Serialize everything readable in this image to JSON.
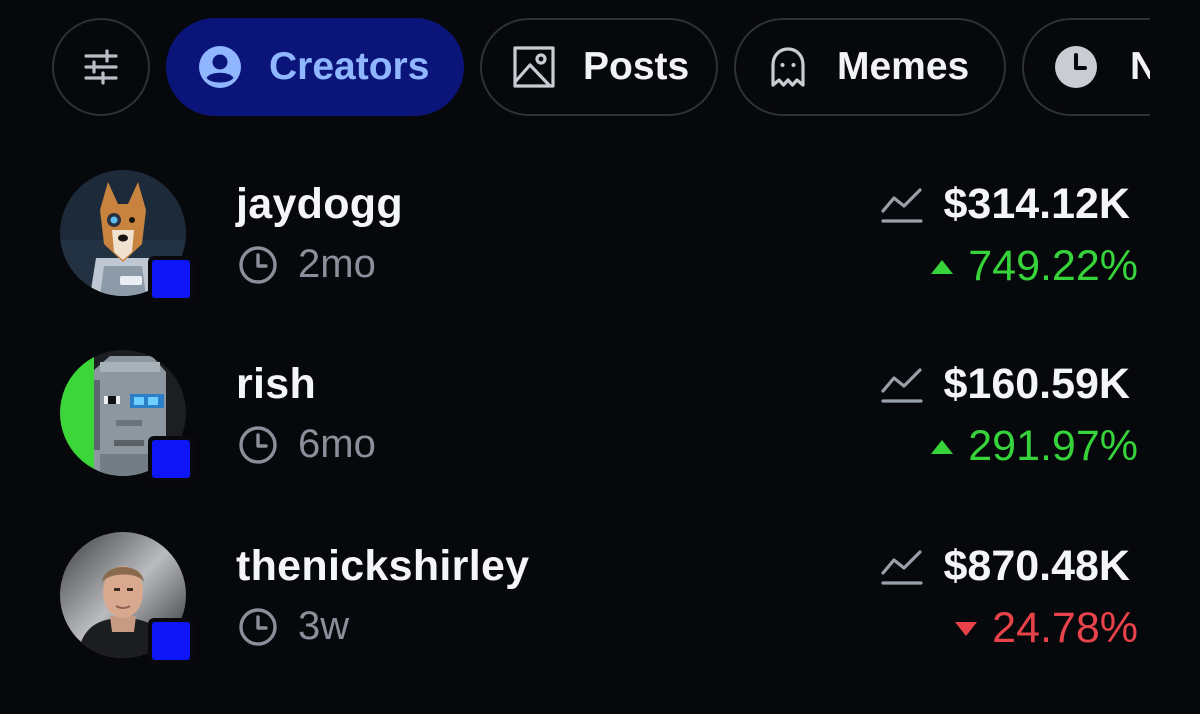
{
  "tabs": {
    "filter_icon": "sliders-icon",
    "items": [
      {
        "label": "Creators",
        "icon": "user-circle-icon",
        "active": true
      },
      {
        "label": "Posts",
        "icon": "image-icon",
        "active": false
      },
      {
        "label": "Memes",
        "icon": "ghost-icon",
        "active": false
      },
      {
        "label": "N",
        "icon": "clock-icon",
        "active": false
      }
    ]
  },
  "creators": [
    {
      "name": "jaydogg",
      "age": "2mo",
      "value": "$314.12K",
      "change": "749.22%",
      "direction": "up"
    },
    {
      "name": "rish",
      "age": "6mo",
      "value": "$160.59K",
      "change": "291.97%",
      "direction": "up"
    },
    {
      "name": "thenickshirley",
      "age": "3w",
      "value": "$870.48K",
      "change": "24.78%",
      "direction": "down"
    }
  ],
  "colors": {
    "background": "#07080b",
    "active_tab_bg": "#0b1478",
    "active_tab_text": "#8fb6ff",
    "positive": "#37d33b",
    "negative": "#e8434a",
    "chain_badge": "#0f16f5",
    "muted_text": "#8a8f99"
  }
}
